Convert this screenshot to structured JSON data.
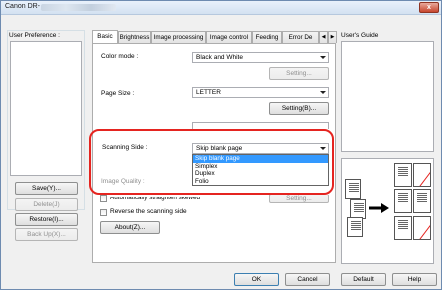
{
  "window": {
    "title": "Canon DR-",
    "close_label": "x"
  },
  "user_preference": {
    "label": "User Preference :",
    "buttons": {
      "save": "Save(Y)...",
      "delete": "Delete(J)",
      "restore": "Restore(I)...",
      "backup": "Back Up(X)..."
    }
  },
  "tabs": [
    "Basic",
    "Brightness",
    "Image processing",
    "Image control",
    "Feeding",
    "Error De"
  ],
  "basic": {
    "color_mode_label": "Color mode :",
    "color_mode_value": "Black and White",
    "setting_disabled": "Setting...",
    "page_size_label": "Page Size :",
    "page_size_value": "LETTER",
    "setting_b": "Setting(B)...",
    "scanning_side_label": "Scanning Side :",
    "scanning_side_value": "Skip blank page",
    "scanning_side_options": [
      "Skip blank page",
      "Simplex",
      "Duplex",
      "Folio"
    ],
    "image_quality_label": "Image Quality :",
    "auto_straighten_label": "Automatically straighten skewed",
    "setting_lower": "Setting...",
    "reverse_label": "Reverse the scanning side",
    "about_label": "About(Z)..."
  },
  "users_guide": {
    "label": "User's Guide"
  },
  "footer": {
    "ok": "OK",
    "cancel": "Cancel",
    "default": "Default",
    "help": "Help"
  }
}
